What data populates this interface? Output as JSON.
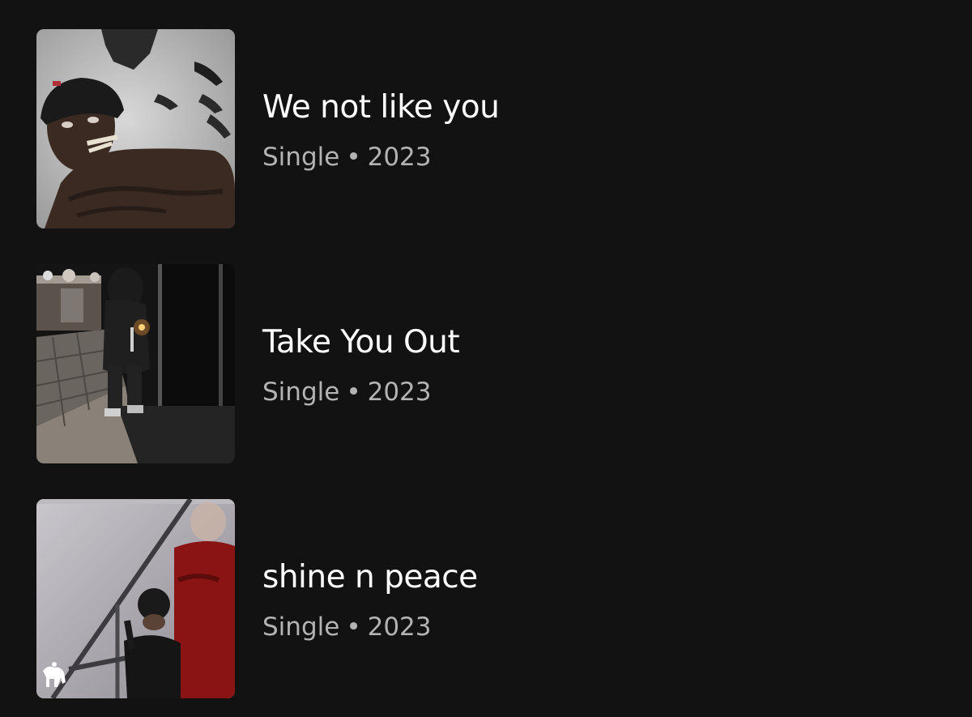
{
  "releases": [
    {
      "title": "We not like you",
      "type": "Single",
      "separator": "•",
      "year": "2023",
      "cover": "cover-art-portrait-smoking"
    },
    {
      "title": "Take You Out",
      "type": "Single",
      "separator": "•",
      "year": "2023",
      "cover": "cover-art-night-patio-lighter"
    },
    {
      "title": "shine n peace",
      "type": "Single",
      "separator": "•",
      "year": "2023",
      "cover": "cover-art-stairwell"
    }
  ],
  "colors": {
    "background": "#121212",
    "title": "#ffffff",
    "meta": "#b3b3b3"
  }
}
